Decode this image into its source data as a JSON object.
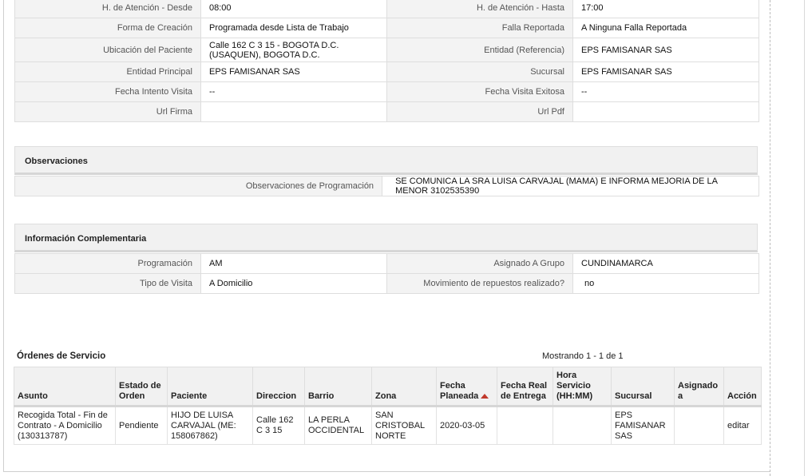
{
  "general": {
    "rows": [
      {
        "l1": "H. de Atención - Desde",
        "v1": "08:00",
        "l2": "H. de Atención - Hasta",
        "v2": "17:00"
      },
      {
        "l1": "Forma de Creación",
        "v1": "Programada desde Lista de Trabajo",
        "l2": "Falla Reportada",
        "v2": "A Ninguna Falla Reportada"
      },
      {
        "l1": "Ubicación del Paciente",
        "v1": "Calle 162 C 3 15 - BOGOTA D.C. (USAQUEN), BOGOTA D.C.",
        "l2": "Entidad (Referencia)",
        "v2": "EPS FAMISANAR SAS"
      },
      {
        "l1": "Entidad Principal",
        "v1": "EPS FAMISANAR SAS",
        "l2": "Sucursal",
        "v2": "EPS FAMISANAR SAS"
      },
      {
        "l1": "Fecha Intento Visita",
        "v1": "--",
        "l2": "Fecha Visita Exitosa",
        "v2": "--"
      },
      {
        "l1": "Url Firma",
        "v1": "",
        "l2": "Url Pdf",
        "v2": ""
      }
    ]
  },
  "observaciones": {
    "title": "Observaciones",
    "label": "Observaciones de Programación",
    "value": "SE COMUNICA LA SRA LUISA CARVAJAL (MAMA) E INFORMA MEJORIA DE LA MENOR 3102535390"
  },
  "complementaria": {
    "title": "Información Complementaria",
    "rows": [
      {
        "l1": "Programación",
        "v1": "AM",
        "l2": "Asignado A Grupo",
        "v2": "CUNDINAMARCA"
      },
      {
        "l1": "Tipo de Visita",
        "v1": "A Domicilio",
        "l2": "Movimiento de repuestos realizado?",
        "v2": "no"
      }
    ]
  },
  "orders": {
    "title": "Órdenes de Servicio",
    "count": "Mostrando 1 - 1 de 1",
    "headers": [
      "Asunto",
      "Estado de Orden",
      "Paciente",
      "Direccion",
      "Barrio",
      "Zona",
      "Fecha Planeada",
      "Fecha Real de Entrega",
      "Hora Servicio (HH:MM)",
      "Sucursal",
      "Asignado a",
      "Acción"
    ],
    "rows": [
      {
        "asunto": "Recogida Total - Fin de Contrato - A Domicilio (130313787)",
        "estado": "Pendiente",
        "paciente": "HIJO DE LUISA CARVAJAL (ME: 158067862)",
        "direccion": "Calle 162 C 3 15",
        "barrio": "LA PERLA OCCIDENTAL",
        "zona": "SAN CRISTOBAL NORTE",
        "fecha_planeada": "2020-03-05",
        "fecha_real": "",
        "hora": "",
        "sucursal": "EPS FAMISANAR SAS",
        "asignado": "",
        "accion": "editar"
      }
    ]
  }
}
